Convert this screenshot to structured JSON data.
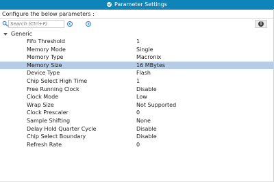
{
  "header": {
    "tab_label": "Parameter Settings"
  },
  "caption": "Configure the below parameters :",
  "search": {
    "placeholder": "Search (Ctrl+F)"
  },
  "icons": {
    "tab": "check-circle-icon",
    "search": "search-icon",
    "prev": "arrow-left-circle-icon",
    "next": "arrow-right-circle-icon",
    "info": "info-icon"
  },
  "colors": {
    "tab_bg": "#0f84b8",
    "selected_row_bg": "#b7cde6"
  },
  "group": {
    "label": "Generic"
  },
  "params": [
    {
      "name": "Fifo Threshold",
      "value": "1"
    },
    {
      "name": "Memory Mode",
      "value": "Single"
    },
    {
      "name": "Memory Type",
      "value": "Macronix"
    },
    {
      "name": "Memory Size",
      "value": "16 MBytes",
      "selected": true
    },
    {
      "name": "Device Type",
      "value": "Flash"
    },
    {
      "name": "Chip Select High Time",
      "value": "1"
    },
    {
      "name": "Free Running Clock",
      "value": "Disable"
    },
    {
      "name": "Clock Mode",
      "value": "Low"
    },
    {
      "name": "Wrap Size",
      "value": "Not Supported"
    },
    {
      "name": "Clock Prescaler",
      "value": "0"
    },
    {
      "name": "Sample Shifting",
      "value": "None"
    },
    {
      "name": "Delay Hold Quarter Cycle",
      "value": "Disable"
    },
    {
      "name": "Chip Select Boundary",
      "value": "Disable"
    },
    {
      "name": "Refresh Rate",
      "value": "0"
    }
  ]
}
